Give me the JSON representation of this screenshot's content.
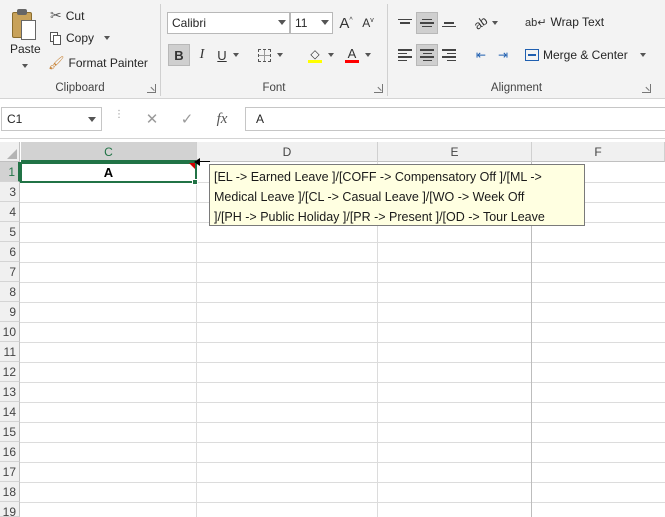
{
  "ribbon": {
    "clipboard": {
      "group_label": "Clipboard",
      "paste_label": "Paste",
      "cut_label": "Cut",
      "copy_label": "Copy",
      "format_painter_label": "Format Painter"
    },
    "font": {
      "group_label": "Font",
      "font_name": "Calibri",
      "font_size": "11",
      "bold_glyph": "B",
      "italic_glyph": "I",
      "underline_glyph": "U",
      "font_color_glyph": "A",
      "grow_glyph": "A",
      "shrink_glyph": "A",
      "underline_color": "#ff0000",
      "highlight_color": "#ffff00"
    },
    "alignment": {
      "group_label": "Alignment",
      "wrap_text_label": "Wrap Text",
      "merge_center_label": "Merge & Center"
    }
  },
  "formula_bar": {
    "name_box_value": "C1",
    "cancel_glyph": "✕",
    "enter_glyph": "✓",
    "fx_glyph": "fx",
    "formula_value": "A"
  },
  "grid": {
    "columns": [
      "C",
      "D",
      "E",
      "F"
    ],
    "rows": [
      "1",
      "3",
      "4",
      "5",
      "6",
      "7",
      "8",
      "9",
      "10",
      "11",
      "12",
      "13",
      "14",
      "15",
      "16",
      "17",
      "18",
      "19"
    ],
    "active_cell_value": "A",
    "accent_color": "#217346"
  },
  "comment": {
    "line1": "[EL -> Earned Leave ]/[COFF -> Compensatory Off ]/[ML ->",
    "line2": "Medical Leave ]/[CL -> Casual Leave ]/[WO -> Week Off",
    "line3": "]/[PH -> Public Holiday ]/[PR -> Present ]/[OD -> Tour Leave"
  }
}
